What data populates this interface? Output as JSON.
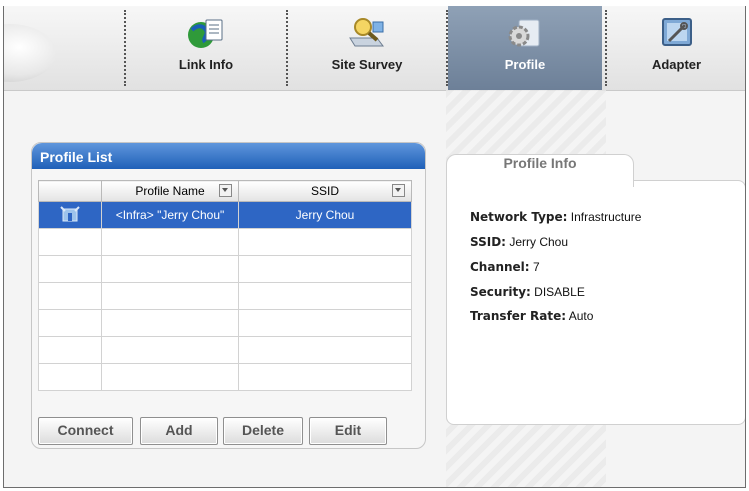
{
  "tabs": [
    {
      "label": "Link Info",
      "icon": "link-info-icon",
      "active": false
    },
    {
      "label": "Site Survey",
      "icon": "site-survey-icon",
      "active": false
    },
    {
      "label": "Profile",
      "icon": "profile-icon",
      "active": true
    },
    {
      "label": "Adapter",
      "icon": "adapter-icon",
      "active": false
    }
  ],
  "profile_list": {
    "title": "Profile List",
    "columns": [
      "Profile Name",
      "SSID"
    ],
    "rows": [
      {
        "icon": "infrastructure-icon",
        "name": "<Infra> \"Jerry Chou\"",
        "ssid": "Jerry Chou",
        "selected": true
      }
    ],
    "buttons": {
      "connect": "Connect",
      "add": "Add",
      "delete": "Delete",
      "edit": "Edit"
    }
  },
  "profile_info": {
    "title": "Profile Info",
    "network_type": {
      "label": "Network Type:",
      "value": "Infrastructure"
    },
    "ssid": {
      "label": "SSID:",
      "value": "Jerry Chou"
    },
    "channel": {
      "label": "Channel:",
      "value": "7"
    },
    "security": {
      "label": "Security:",
      "value": "DISABLE"
    },
    "transfer_rate": {
      "label": "Transfer Rate:",
      "value": "Auto"
    }
  },
  "colors": {
    "accent": "#2e66c4",
    "title_bar": "#3a7bd0",
    "active_tab": "#7b8ea6"
  }
}
